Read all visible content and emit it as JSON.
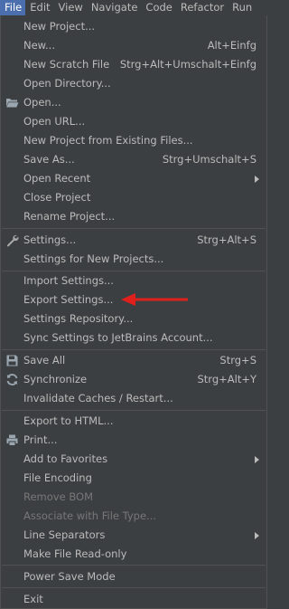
{
  "menubar": {
    "items": [
      {
        "label": "File",
        "active": true
      },
      {
        "label": "Edit"
      },
      {
        "label": "View"
      },
      {
        "label": "Navigate"
      },
      {
        "label": "Code"
      },
      {
        "label": "Refactor"
      },
      {
        "label": "Run"
      }
    ]
  },
  "file_menu": {
    "items": [
      {
        "label": "New Project...",
        "shortcut": ""
      },
      {
        "label": "New...",
        "shortcut": "Alt+Einfg"
      },
      {
        "label": "New Scratch File",
        "shortcut": "Strg+Alt+Umschalt+Einfg"
      },
      {
        "label": "Open Directory...",
        "shortcut": ""
      },
      {
        "label": "Open...",
        "shortcut": "",
        "icon": "folder-icon"
      },
      {
        "label": "Open URL...",
        "shortcut": ""
      },
      {
        "label": "New Project from Existing Files...",
        "shortcut": ""
      },
      {
        "label": "Save As...",
        "shortcut": "Strg+Umschalt+S"
      },
      {
        "label": "Open Recent",
        "shortcut": "",
        "submenu": true
      },
      {
        "label": "Close Project",
        "shortcut": ""
      },
      {
        "label": "Rename Project...",
        "shortcut": ""
      },
      {
        "label": "Settings...",
        "shortcut": "Strg+Alt+S",
        "icon": "wrench-icon"
      },
      {
        "label": "Settings for New Projects...",
        "shortcut": ""
      },
      {
        "label": "Import Settings...",
        "shortcut": ""
      },
      {
        "label": "Export Settings...",
        "shortcut": ""
      },
      {
        "label": "Settings Repository...",
        "shortcut": ""
      },
      {
        "label": "Sync Settings to JetBrains Account...",
        "shortcut": ""
      },
      {
        "label": "Save All",
        "shortcut": "Strg+S",
        "icon": "save-icon"
      },
      {
        "label": "Synchronize",
        "shortcut": "Strg+Alt+Y",
        "icon": "sync-icon"
      },
      {
        "label": "Invalidate Caches / Restart...",
        "shortcut": ""
      },
      {
        "label": "Export to HTML...",
        "shortcut": ""
      },
      {
        "label": "Print...",
        "shortcut": "",
        "icon": "printer-icon"
      },
      {
        "label": "Add to Favorites",
        "shortcut": "",
        "submenu": true
      },
      {
        "label": "File Encoding",
        "shortcut": ""
      },
      {
        "label": "Remove BOM",
        "shortcut": "",
        "disabled": true
      },
      {
        "label": "Associate with File Type...",
        "shortcut": "",
        "disabled": true
      },
      {
        "label": "Line Separators",
        "shortcut": "",
        "submenu": true
      },
      {
        "label": "Make File Read-only",
        "shortcut": ""
      },
      {
        "label": "Power Save Mode",
        "shortcut": ""
      },
      {
        "label": "Exit",
        "shortcut": ""
      }
    ]
  },
  "colors": {
    "background": "#3c3f41",
    "text": "#bbbbbb",
    "disabled_text": "#777777",
    "active_menu": "#4b6eaf",
    "separator": "#515151",
    "annotation_arrow": "#e0201c"
  }
}
